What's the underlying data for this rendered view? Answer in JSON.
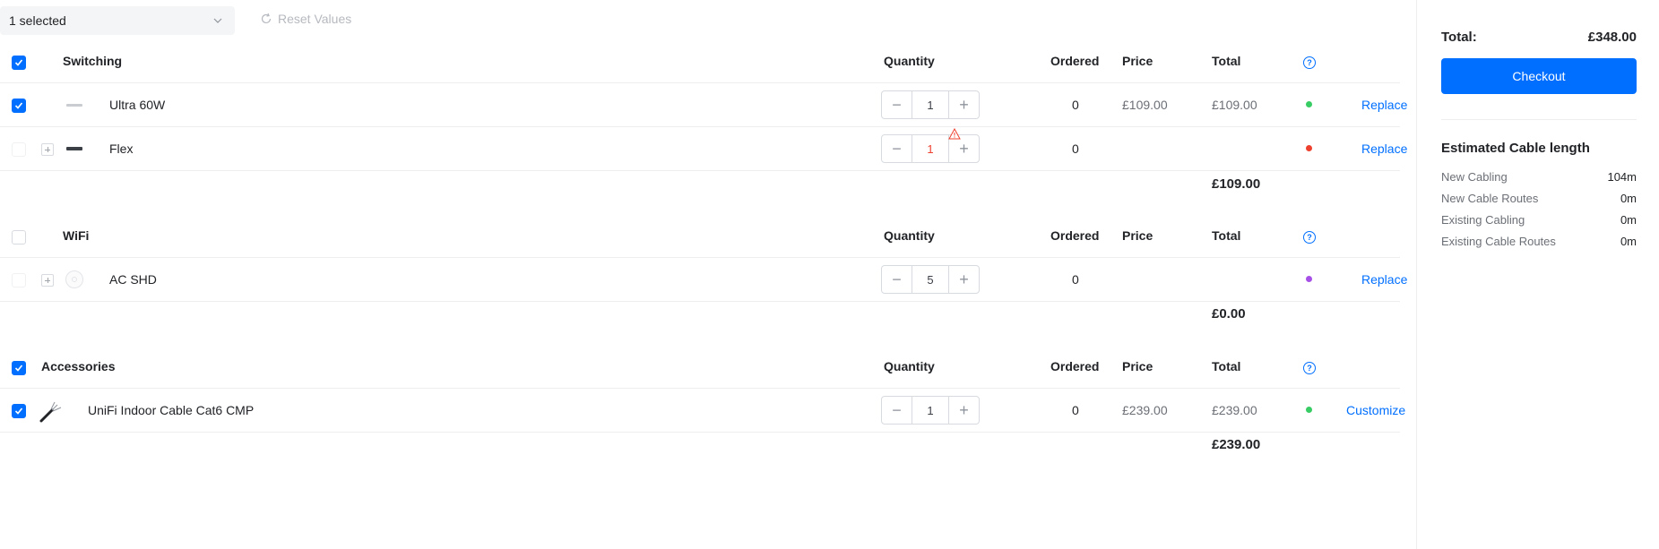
{
  "toolbar": {
    "selection_label": "1 selected",
    "reset_label": "Reset Values"
  },
  "columns": {
    "quantity": "Quantity",
    "ordered": "Ordered",
    "price": "Price",
    "total": "Total",
    "help": "?"
  },
  "sections": [
    {
      "title": "Switching",
      "checked": true,
      "subtotal": "£109.00",
      "rows": [
        {
          "name": "Ultra 60W",
          "checked": true,
          "quantity": "1",
          "ordered": "0",
          "price": "£109.00",
          "total": "£109.00",
          "status_color": "#38cc65",
          "action": "Replace",
          "warning": false
        },
        {
          "name": "Flex",
          "checked": false,
          "quantity": "1",
          "ordered": "0",
          "price": "",
          "total": "",
          "status_color": "#ee402e",
          "action": "Replace",
          "warning": true
        }
      ]
    },
    {
      "title": "WiFi",
      "checked": false,
      "subtotal": "£0.00",
      "rows": [
        {
          "name": "AC SHD",
          "checked": false,
          "quantity": "5",
          "ordered": "0",
          "price": "",
          "total": "",
          "status_color": "#a750e8",
          "action": "Replace",
          "warning": false
        }
      ]
    },
    {
      "title": "Accessories",
      "checked": true,
      "subtotal": "£239.00",
      "rows": [
        {
          "name": "UniFi Indoor Cable Cat6 CMP",
          "checked": true,
          "quantity": "1",
          "ordered": "0",
          "price": "£239.00",
          "total": "£239.00",
          "status_color": "#38cc65",
          "action": "Customize",
          "warning": false
        }
      ]
    }
  ],
  "sidebar": {
    "total_label": "Total:",
    "total_value": "£348.00",
    "checkout_label": "Checkout",
    "cable_title": "Estimated Cable length",
    "cable_lines": [
      {
        "label": "New Cabling",
        "value": "104m"
      },
      {
        "label": "New Cable Routes",
        "value": "0m"
      },
      {
        "label": "Existing Cabling",
        "value": "0m"
      },
      {
        "label": "Existing Cable Routes",
        "value": "0m"
      }
    ]
  },
  "colors": {
    "accent": "#006fff",
    "status_green": "#38cc65",
    "status_red": "#ee402e",
    "status_purple": "#a750e8"
  }
}
